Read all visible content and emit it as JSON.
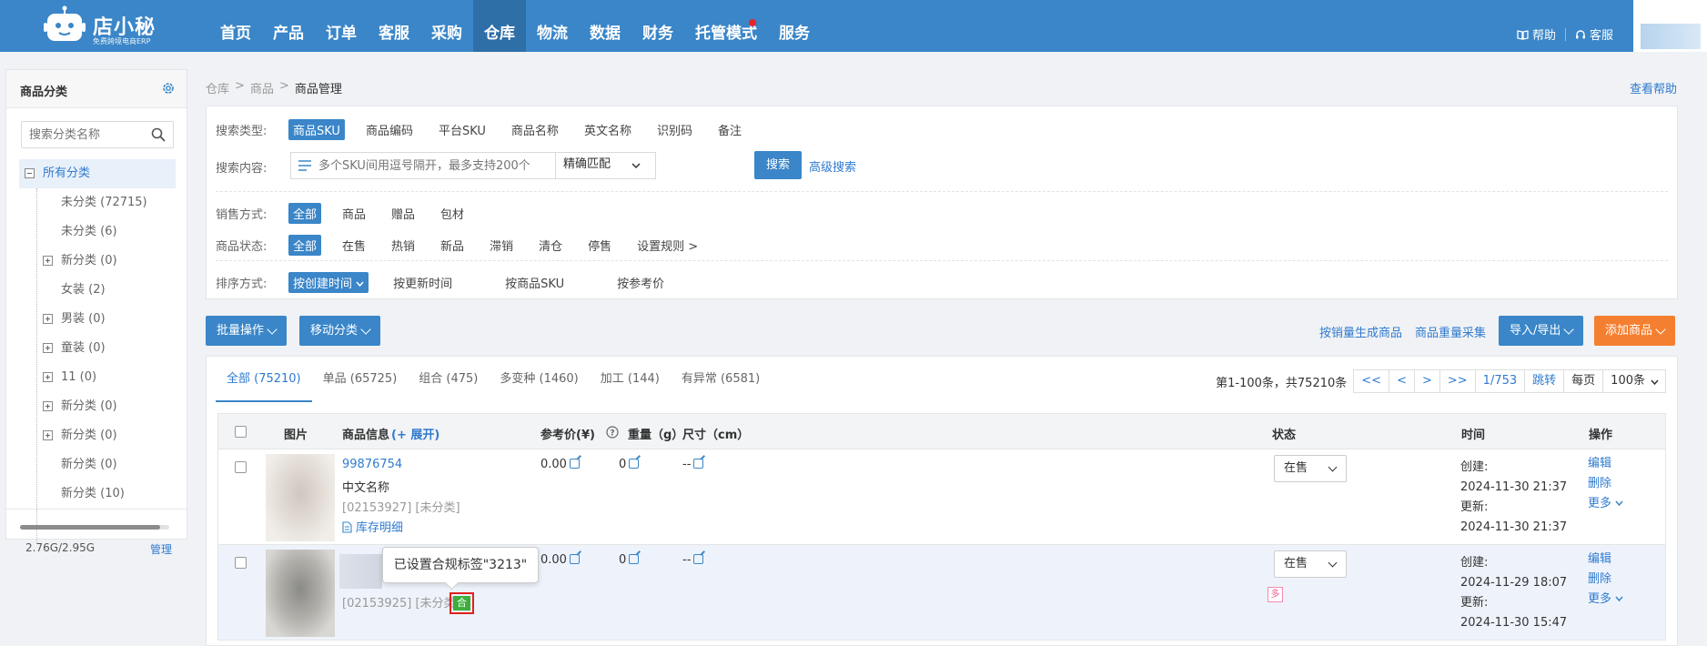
{
  "header": {
    "logo_name": "店小秘",
    "logo_sub": "免费跨境电商ERP",
    "nav": [
      {
        "label": "首页"
      },
      {
        "label": "产品"
      },
      {
        "label": "订单"
      },
      {
        "label": "客服"
      },
      {
        "label": "采购"
      },
      {
        "label": "仓库"
      },
      {
        "label": "物流"
      },
      {
        "label": "数据"
      },
      {
        "label": "财务"
      },
      {
        "label": "托管模式"
      },
      {
        "label": "服务"
      }
    ],
    "active_nav": "仓库",
    "help": "帮助",
    "service": "客服"
  },
  "sidebar": {
    "title": "商品分类",
    "search_placeholder": "搜索分类名称",
    "tree": [
      {
        "label": "所有分类"
      },
      {
        "label": "未分类 (72715)"
      },
      {
        "label": "未分类 (6)"
      },
      {
        "label": "新分类 (0)"
      },
      {
        "label": "女装 (2)"
      },
      {
        "label": "男装 (0)"
      },
      {
        "label": "童装 (0)"
      },
      {
        "label": "11 (0)"
      },
      {
        "label": "新分类 (0)"
      },
      {
        "label": "新分类 (0)"
      },
      {
        "label": "新分类 (0)"
      },
      {
        "label": "新分类 (10)"
      }
    ],
    "storage": "2.76G/2.95G",
    "storage_fraction": 0.936,
    "manage": "管理"
  },
  "breadcrumb": {
    "a": "仓库",
    "b": "商品",
    "c": "商品管理",
    "sep": ">"
  },
  "help_link": "查看帮助",
  "filter": {
    "search_type_label": "搜索类型:",
    "search_types": [
      "商品SKU",
      "商品编码",
      "平台SKU",
      "商品名称",
      "英文名称",
      "识别码",
      "备注"
    ],
    "content_label": "搜索内容:",
    "content_placeholder": "多个SKU间用逗号隔开，最多支持200个",
    "match_mode": "精确匹配",
    "search_btn": "搜索",
    "advanced": "高级搜索",
    "sale_label": "销售方式:",
    "sale_opts": [
      "全部",
      "商品",
      "赠品",
      "包材"
    ],
    "status_label": "商品状态:",
    "status_opts": [
      "全部",
      "在售",
      "热销",
      "新品",
      "滞销",
      "清仓",
      "停售",
      "设置规则 >"
    ],
    "sort_label": "排序方式:",
    "sort_opts": [
      "按创建时间",
      "按更新时间",
      "按商品SKU",
      "按参考价"
    ]
  },
  "actions": {
    "batch": "批量操作",
    "move": "移动分类",
    "gen_by_sales": "按销量生成商品",
    "weight_collect": "商品重量采集",
    "import_export": "导入/导出",
    "add_product": "添加商品"
  },
  "tabs": [
    "全部 (75210)",
    "单品 (65725)",
    "组合 (475)",
    "多变种 (1460)",
    "加工 (144)",
    "有异常 (6581)"
  ],
  "pager": {
    "summary": "第1-100条，共75210条",
    "first": "<<",
    "prev": "<",
    "next": ">",
    "last": ">>",
    "page": "1/753",
    "jump": "跳转",
    "per_label": "每页",
    "per": "100条"
  },
  "table": {
    "headers": {
      "image": "图片",
      "info": "商品信息",
      "expand": "(+ 展开)",
      "price": "参考价(¥)",
      "weight": "重量（g）",
      "size": "尺寸（cm）",
      "status": "状态",
      "time": "时间",
      "ops": "操作"
    },
    "rows": [
      {
        "sku": "99876754",
        "name": "中文名称",
        "meta": "[02153927] [未分类]",
        "stock_link": "库存明细",
        "price": "0.00",
        "weight": "0",
        "size": "--",
        "status": "在售",
        "created_label": "创建:",
        "created": "2024-11-30 21:37",
        "updated_label": "更新:",
        "updated": "2024-11-30 21:37",
        "op_edit": "编辑",
        "op_delete": "删除",
        "op_more": "更多"
      },
      {
        "meta": "[02153925] [未分类]",
        "tag": "合",
        "price": "0.00",
        "weight": "0",
        "size": "--",
        "status": "在售",
        "multi_tag": "多",
        "created_label": "创建:",
        "created": "2024-11-29 18:07",
        "updated_label": "更新:",
        "updated": "2024-11-30 15:47",
        "op_edit": "编辑",
        "op_delete": "删除",
        "op_more": "更多"
      }
    ]
  },
  "tooltip": "已设置合规标签\"3213\""
}
